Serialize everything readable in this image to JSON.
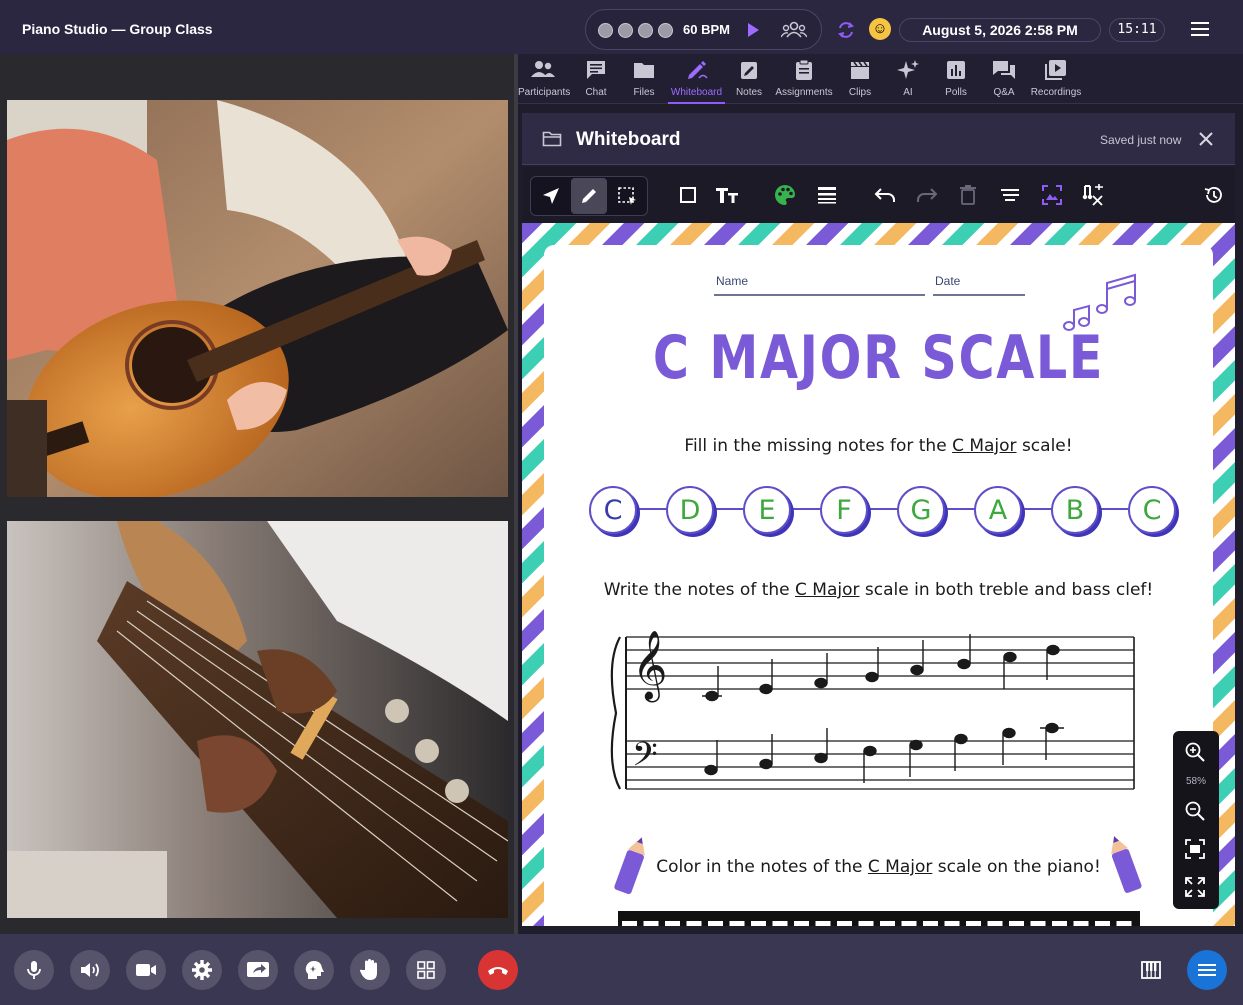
{
  "app": {
    "title": "Piano Studio — Group Class"
  },
  "metronome": {
    "bpm_label": "60 BPM",
    "beats": 4
  },
  "header": {
    "datetime": "August 5, 2026 2:58 PM",
    "timer": "15:11",
    "icons": [
      "play-icon",
      "group-icon",
      "sync-icon",
      "emoji-icon",
      "menu-icon"
    ]
  },
  "tabs": [
    {
      "label": "Participants",
      "icon": "people-icon"
    },
    {
      "label": "Chat",
      "icon": "chat-icon"
    },
    {
      "label": "Files",
      "icon": "folder-icon"
    },
    {
      "label": "Whiteboard",
      "icon": "whiteboard-icon",
      "active": true
    },
    {
      "label": "Notes",
      "icon": "notes-icon"
    },
    {
      "label": "Assignments",
      "icon": "clipboard-icon"
    },
    {
      "label": "Clips",
      "icon": "clapper-icon"
    },
    {
      "label": "AI",
      "icon": "sparkle-icon"
    },
    {
      "label": "Polls",
      "icon": "poll-icon"
    },
    {
      "label": "Q&A",
      "icon": "qa-icon"
    },
    {
      "label": "Recordings",
      "icon": "recording-icon"
    }
  ],
  "whiteboard": {
    "title": "Whiteboard",
    "saved_status": "Saved just now",
    "zoom_level": "58%"
  },
  "worksheet": {
    "name_label": "Name",
    "date_label": "Date",
    "title": "C MAJOR SCALE",
    "instruction_1_before": "Fill in the missing notes for the ",
    "instruction_1_link": "C Major",
    "instruction_1_after": " scale!",
    "notes": [
      {
        "letter": "C",
        "color": "#3a3aa8"
      },
      {
        "letter": "D",
        "color": "#3ea83e"
      },
      {
        "letter": "E",
        "color": "#3ea83e"
      },
      {
        "letter": "F",
        "color": "#3ea83e"
      },
      {
        "letter": "G",
        "color": "#3ea83e"
      },
      {
        "letter": "A",
        "color": "#3ea83e"
      },
      {
        "letter": "B",
        "color": "#3ea83e"
      },
      {
        "letter": "C",
        "color": "#3ea83e"
      }
    ],
    "instruction_2_before": "Write the notes of the ",
    "instruction_2_link": "C Major",
    "instruction_2_after": " scale in both treble and bass clef!",
    "instruction_3_before": "Color in the notes of the ",
    "instruction_3_link": "C Major",
    "instruction_3_after": " scale on the piano!"
  },
  "colors": {
    "accent": "#8f5cf7",
    "stripe_purple": "#7b5ad8",
    "stripe_teal": "#3ccfb3",
    "stripe_orange": "#f4b860",
    "end_call": "#d93434"
  },
  "bottom_controls": [
    "microphone-icon",
    "speaker-icon",
    "camera-icon",
    "settings-icon",
    "screen-share-icon",
    "ai-assistant-icon",
    "raise-hand-icon",
    "grid-layout-icon",
    "end-call-icon",
    "piano-icon",
    "more-menu-icon"
  ]
}
